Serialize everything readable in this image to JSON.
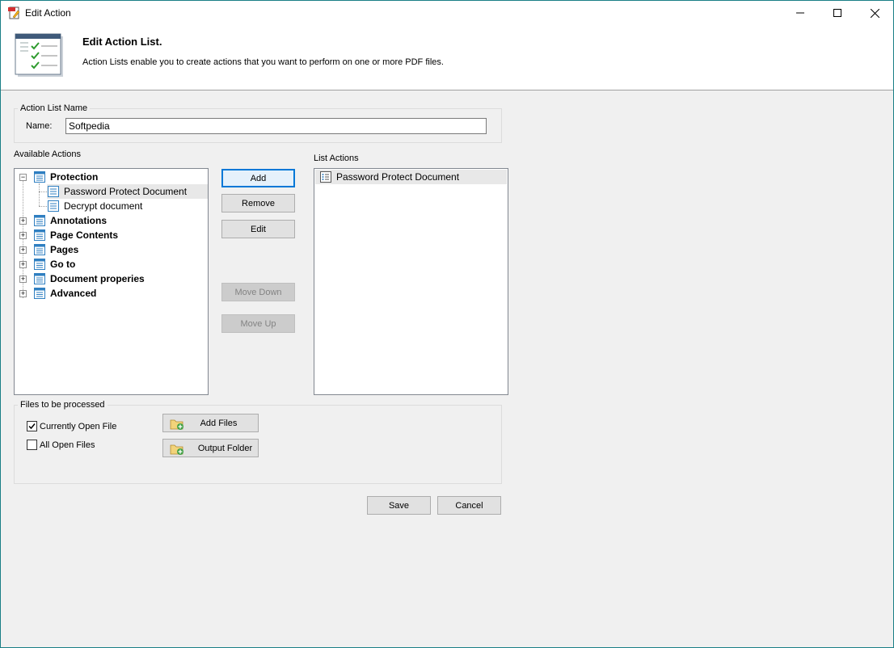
{
  "window": {
    "title": "Edit Action"
  },
  "header": {
    "title": "Edit Action List.",
    "description": "Action Lists enable you to create actions that you want to perform on one or more PDF files."
  },
  "name_group": {
    "legend": "Action List Name",
    "name_label": "Name:",
    "name_value": "Softpedia"
  },
  "available": {
    "label": "Available Actions",
    "tree": [
      {
        "label": "Protection",
        "expanded": true,
        "children": [
          {
            "label": "Password Protect Document",
            "selected": true
          },
          {
            "label": "Decrypt document"
          }
        ]
      },
      {
        "label": "Annotations",
        "expanded": false
      },
      {
        "label": "Page Contents",
        "expanded": false
      },
      {
        "label": "Pages",
        "expanded": false
      },
      {
        "label": "Go to",
        "expanded": false
      },
      {
        "label": "Document properies",
        "expanded": false
      },
      {
        "label": "Advanced",
        "expanded": false
      }
    ]
  },
  "buttons": {
    "add": "Add",
    "remove": "Remove",
    "edit": "Edit",
    "move_down": "Move Down",
    "move_up": "Move Up",
    "save": "Save",
    "cancel": "Cancel"
  },
  "list_actions": {
    "label": "List Actions",
    "items": [
      "Password Protect Document"
    ]
  },
  "files_group": {
    "legend": "Files to be processed",
    "current_file_label": "Currently Open File",
    "current_file_checked": true,
    "all_files_label": "All Open Files",
    "all_files_checked": false,
    "add_files": "Add Files",
    "output_folder": "Output Folder"
  },
  "colors": {
    "accent": "#0078d7",
    "window_border": "#1a7f86",
    "doc_icon_blue": "#2f7fc1"
  }
}
